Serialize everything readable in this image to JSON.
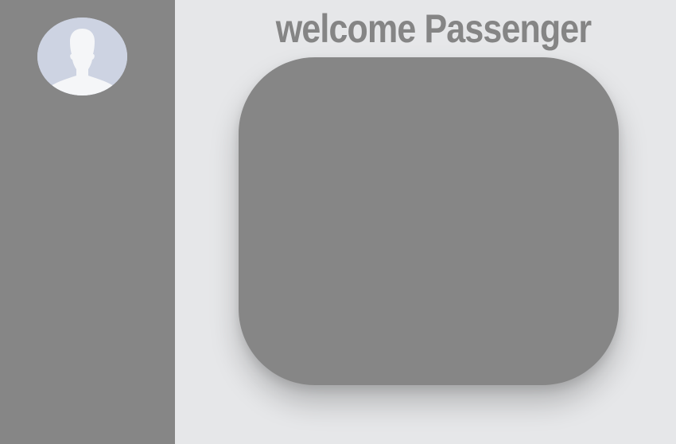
{
  "sidebar": {
    "avatar": {
      "icon": "user-silhouette-icon",
      "background_color": "#cdd3e2",
      "silhouette_color": "#f5f6f8"
    },
    "background_color": "#868686"
  },
  "main": {
    "welcome_title": "welcome Passenger",
    "card_color": "#868686",
    "background_color": "#e6e7e9"
  }
}
